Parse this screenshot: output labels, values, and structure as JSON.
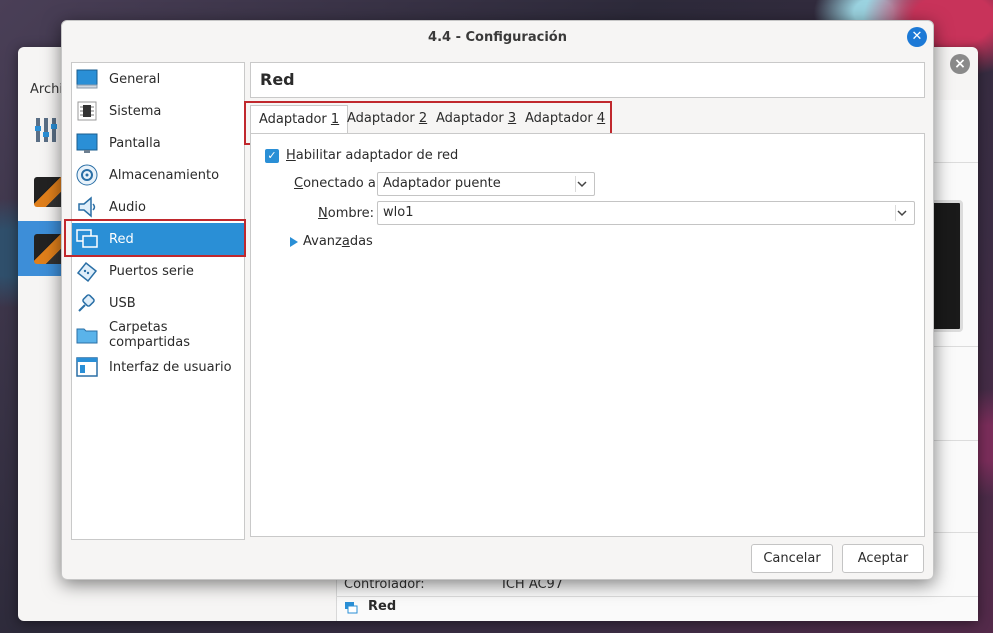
{
  "dialog": {
    "title": "4.4 - Configuración",
    "close_icon": "close-icon"
  },
  "background_window": {
    "menu_label": "Archi",
    "rows": [
      {
        "label": "Controlador:",
        "value": "ICH AC97"
      }
    ],
    "section_title": "Red"
  },
  "sidebar": {
    "items": [
      {
        "label": "General",
        "icon": "general-icon",
        "selected": false
      },
      {
        "label": "Sistema",
        "icon": "chip-icon",
        "selected": false
      },
      {
        "label": "Pantalla",
        "icon": "monitor-icon",
        "selected": false
      },
      {
        "label": "Almacenamiento",
        "icon": "disk-icon",
        "selected": false
      },
      {
        "label": "Audio",
        "icon": "speaker-icon",
        "selected": false
      },
      {
        "label": "Red",
        "icon": "network-icon",
        "selected": true
      },
      {
        "label": "Puertos serie",
        "icon": "serial-port-icon",
        "selected": false
      },
      {
        "label": "USB",
        "icon": "usb-icon",
        "selected": false
      },
      {
        "label": "Carpetas compartidas",
        "icon": "shared-folder-icon",
        "selected": false
      },
      {
        "label": "Interfaz de usuario",
        "icon": "window-icon",
        "selected": false
      }
    ]
  },
  "page": {
    "title": "Red"
  },
  "tabs": [
    {
      "label": "Adaptador ",
      "mnemonic": "1",
      "active": true
    },
    {
      "label": "Adaptador ",
      "mnemonic": "2",
      "active": false
    },
    {
      "label": "Adaptador ",
      "mnemonic": "3",
      "active": false
    },
    {
      "label": "Adaptador ",
      "mnemonic": "4",
      "active": false
    }
  ],
  "adapter": {
    "enable_mnemonic": "H",
    "enable_label_rest": "abilitar adaptador de red",
    "enable_checked": true,
    "attached_mnemonic": "C",
    "attached_label_rest": "onectado a:",
    "attached_value": "Adaptador puente",
    "name_mnemonic": "N",
    "name_label_rest": "ombre:",
    "name_value": "wlo1",
    "advanced_label_pre": "Avanz",
    "advanced_mnemonic": "a",
    "advanced_label_post": "das"
  },
  "buttons": {
    "cancel": "Cancelar",
    "accept": "Aceptar"
  },
  "colors": {
    "accent": "#2a8fd6",
    "highlight_border": "#c0282d"
  }
}
